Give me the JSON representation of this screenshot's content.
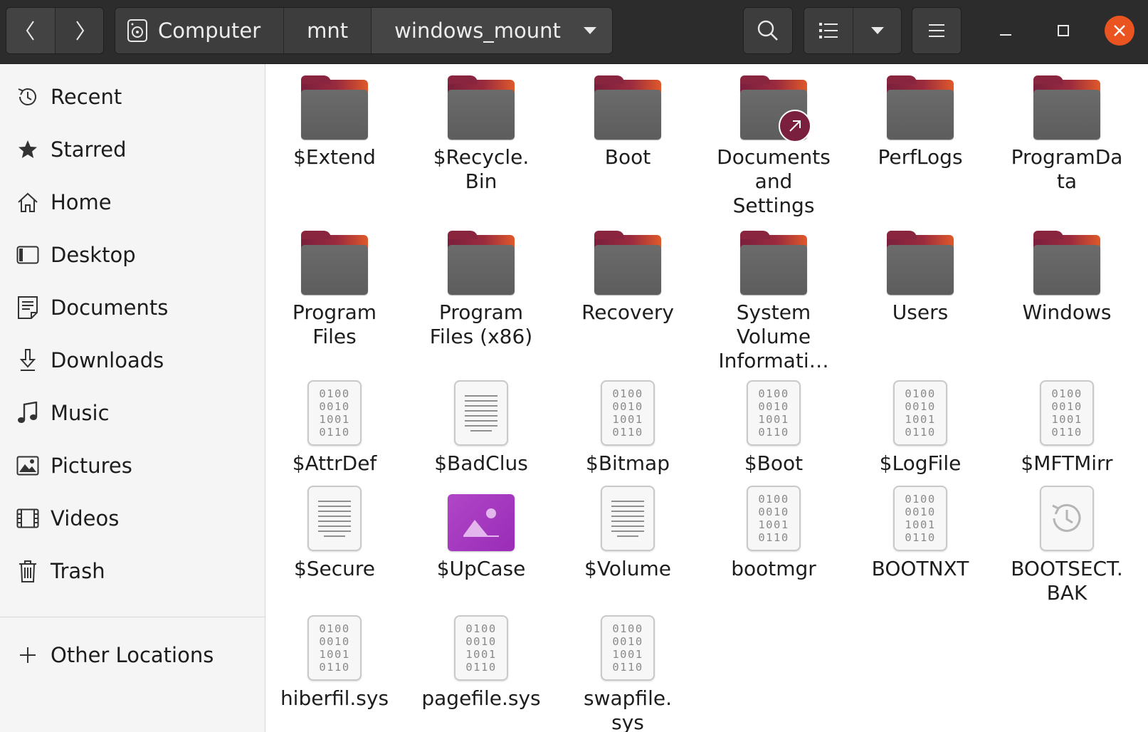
{
  "header": {
    "nav": {
      "back_icon": "chevron-left-icon",
      "forward_icon": "chevron-right-icon"
    },
    "path": [
      {
        "label": "Computer",
        "icon": "drive-icon"
      },
      {
        "label": "mnt"
      },
      {
        "label": "windows_mount",
        "icon": "dropdown-arrow-icon"
      }
    ],
    "search_icon": "search-icon",
    "view_icon": "list-view-icon",
    "view_dropdown_icon": "dropdown-arrow-icon",
    "menu_icon": "hamburger-menu-icon",
    "window": {
      "min": "minimize-icon",
      "max": "maximize-icon",
      "close": "close-icon",
      "close_color": "#e95420"
    }
  },
  "sidebar": {
    "items": [
      {
        "label": "Recent",
        "icon": "clock-icon"
      },
      {
        "label": "Starred",
        "icon": "star-icon"
      },
      {
        "label": "Home",
        "icon": "home-icon"
      },
      {
        "label": "Desktop",
        "icon": "desktop-icon"
      },
      {
        "label": "Documents",
        "icon": "documents-icon"
      },
      {
        "label": "Downloads",
        "icon": "download-icon"
      },
      {
        "label": "Music",
        "icon": "music-icon"
      },
      {
        "label": "Pictures",
        "icon": "pictures-icon"
      },
      {
        "label": "Videos",
        "icon": "videos-icon"
      },
      {
        "label": "Trash",
        "icon": "trash-icon"
      }
    ],
    "other": {
      "label": "Other Locations",
      "icon": "plus-icon"
    }
  },
  "files": [
    {
      "name": "$Extend",
      "type": "folder"
    },
    {
      "name": "$Recycle.\nBin",
      "type": "folder"
    },
    {
      "name": "Boot",
      "type": "folder"
    },
    {
      "name": "Documents\nand\nSettings",
      "type": "folder-link"
    },
    {
      "name": "PerfLogs",
      "type": "folder"
    },
    {
      "name": "ProgramDa\nta",
      "type": "folder"
    },
    {
      "name": "Program\nFiles",
      "type": "folder"
    },
    {
      "name": "Program\nFiles (x86)",
      "type": "folder"
    },
    {
      "name": "Recovery",
      "type": "folder"
    },
    {
      "name": "System\nVolume\nInformati…",
      "type": "folder"
    },
    {
      "name": "Users",
      "type": "folder"
    },
    {
      "name": "Windows",
      "type": "folder"
    },
    {
      "name": "$AttrDef",
      "type": "binary"
    },
    {
      "name": "$BadClus",
      "type": "text"
    },
    {
      "name": "$Bitmap",
      "type": "binary"
    },
    {
      "name": "$Boot",
      "type": "binary"
    },
    {
      "name": "$LogFile",
      "type": "binary"
    },
    {
      "name": "$MFTMirr",
      "type": "binary"
    },
    {
      "name": "$Secure",
      "type": "text"
    },
    {
      "name": "$UpCase",
      "type": "image"
    },
    {
      "name": "$Volume",
      "type": "text"
    },
    {
      "name": "bootmgr",
      "type": "binary"
    },
    {
      "name": "BOOTNXT",
      "type": "binary"
    },
    {
      "name": "BOOTSECT.\nBAK",
      "type": "backup"
    },
    {
      "name": "hiberfil.sys",
      "type": "binary"
    },
    {
      "name": "pagefile.sys",
      "type": "binary"
    },
    {
      "name": "swapfile.\nsys",
      "type": "binary"
    }
  ],
  "binary_glyph": [
    "0100",
    "0010",
    "1001",
    "0110"
  ]
}
